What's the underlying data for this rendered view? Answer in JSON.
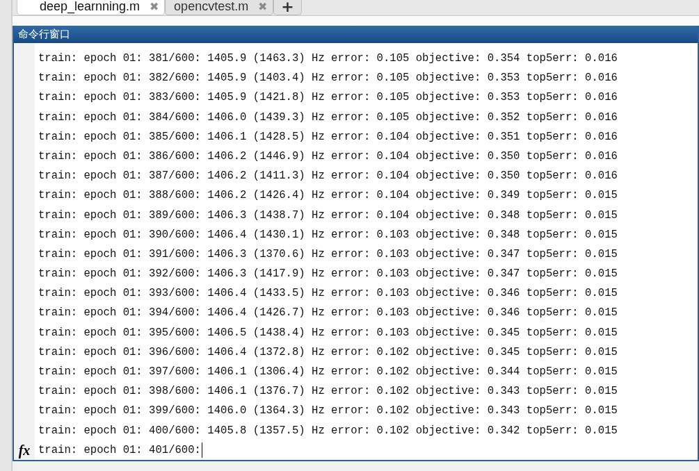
{
  "tabs": [
    {
      "label": "deep_learnning.m",
      "selected": true,
      "close": "✖"
    },
    {
      "label": "opencvtest.m",
      "selected": false,
      "close": "✖"
    }
  ],
  "new_tab": "+",
  "function_button": "fx",
  "command_window": {
    "title": "命令行窗口",
    "lines": [
      "train: epoch 01: 381/600: 1405.9 (1463.3) Hz error: 0.105 objective: 0.354 top5err: 0.016",
      "train: epoch 01: 382/600: 1405.9 (1403.4) Hz error: 0.105 objective: 0.353 top5err: 0.016",
      "train: epoch 01: 383/600: 1405.9 (1421.8) Hz error: 0.105 objective: 0.353 top5err: 0.016",
      "train: epoch 01: 384/600: 1406.0 (1439.3) Hz error: 0.105 objective: 0.352 top5err: 0.016",
      "train: epoch 01: 385/600: 1406.1 (1428.5) Hz error: 0.104 objective: 0.351 top5err: 0.016",
      "train: epoch 01: 386/600: 1406.2 (1446.9) Hz error: 0.104 objective: 0.350 top5err: 0.016",
      "train: epoch 01: 387/600: 1406.2 (1411.3) Hz error: 0.104 objective: 0.350 top5err: 0.016",
      "train: epoch 01: 388/600: 1406.2 (1426.4) Hz error: 0.104 objective: 0.349 top5err: 0.015",
      "train: epoch 01: 389/600: 1406.3 (1438.7) Hz error: 0.104 objective: 0.348 top5err: 0.015",
      "train: epoch 01: 390/600: 1406.4 (1430.1) Hz error: 0.103 objective: 0.348 top5err: 0.015",
      "train: epoch 01: 391/600: 1406.3 (1370.6) Hz error: 0.103 objective: 0.347 top5err: 0.015",
      "train: epoch 01: 392/600: 1406.3 (1417.9) Hz error: 0.103 objective: 0.347 top5err: 0.015",
      "train: epoch 01: 393/600: 1406.4 (1433.5) Hz error: 0.103 objective: 0.346 top5err: 0.015",
      "train: epoch 01: 394/600: 1406.4 (1426.7) Hz error: 0.103 objective: 0.346 top5err: 0.015",
      "train: epoch 01: 395/600: 1406.5 (1438.4) Hz error: 0.103 objective: 0.345 top5err: 0.015",
      "train: epoch 01: 396/600: 1406.4 (1372.8) Hz error: 0.102 objective: 0.345 top5err: 0.015",
      "train: epoch 01: 397/600: 1406.1 (1306.4) Hz error: 0.102 objective: 0.344 top5err: 0.015",
      "train: epoch 01: 398/600: 1406.1 (1376.7) Hz error: 0.102 objective: 0.343 top5err: 0.015",
      "train: epoch 01: 399/600: 1406.0 (1364.3) Hz error: 0.102 objective: 0.343 top5err: 0.015",
      "train: epoch 01: 400/600: 1405.8 (1357.5) Hz error: 0.102 objective: 0.342 top5err: 0.015"
    ],
    "prompt": "train: epoch 01: 401/600:"
  }
}
